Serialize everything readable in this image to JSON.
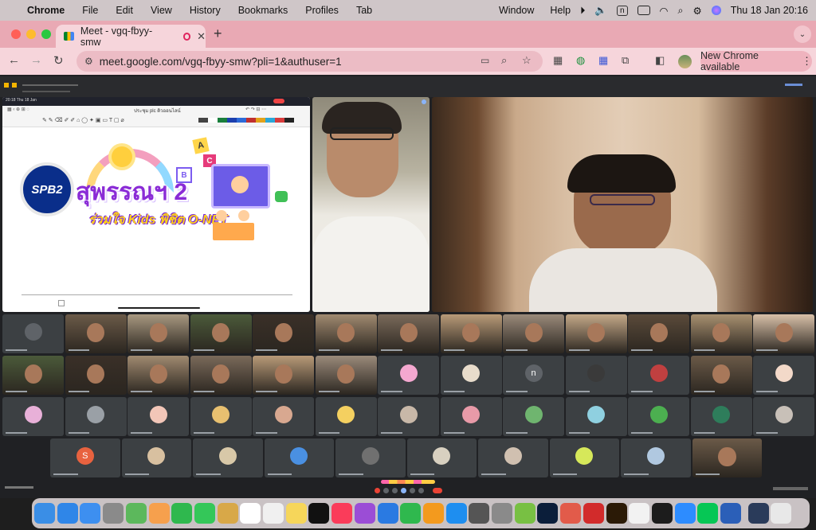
{
  "menubar": {
    "app": "Chrome",
    "items": [
      "File",
      "Edit",
      "View",
      "History",
      "Bookmarks",
      "Profiles",
      "Tab",
      "Window",
      "Help"
    ],
    "clock": "Thu 18 Jan  20:16",
    "input_badge": "n"
  },
  "browser": {
    "tab_title": "Meet - vgq-fbyy-smw",
    "url": "meet.google.com/vgq-fbyy-smw?pli=1&authuser=1",
    "new_chrome": "New Chrome available"
  },
  "presentation": {
    "ipad_time": "20:18  Thu 18 Jan",
    "doc_title": "ประชุม plc ติวออนไลน์",
    "logo_text": "SPB2",
    "headline": "สุพรรณฯ 2",
    "subline": "ร่วมใจ Kids พิชิต O-NET",
    "letters": [
      "A",
      "B",
      "C"
    ]
  },
  "participant_initials": [
    "S",
    "n"
  ],
  "colors": {
    "menubar": "#cfc6c8",
    "tabstrip": "#e9a9b4",
    "toolbar": "#f6d5db",
    "meet_bg": "#202124",
    "tile_bg": "#3c4043",
    "end_call": "#ea4335"
  }
}
